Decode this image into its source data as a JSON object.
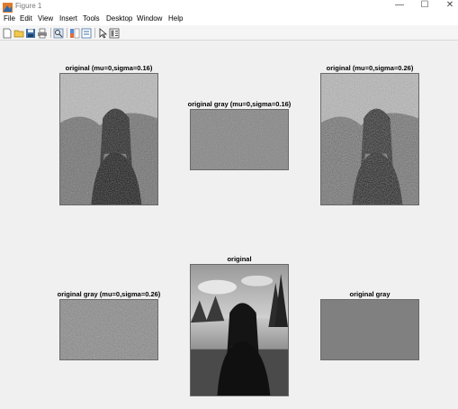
{
  "window": {
    "title": "Figure 1",
    "minimize": "—",
    "maximize": "☐",
    "close": "✕"
  },
  "menu": {
    "items": [
      "File",
      "Edit",
      "View",
      "Insert",
      "Tools",
      "Desktop",
      "Window",
      "Help"
    ]
  },
  "toolbar": {
    "buttons": [
      "new-figure-icon",
      "open-file-icon",
      "save-icon",
      "print-icon",
      "zoom-icon",
      "colorbar-icon",
      "insert-legend-icon",
      "pointer-icon",
      "property-inspector-icon"
    ]
  },
  "figure": {
    "subplots": [
      {
        "title": "original (mu=0,sigma=0.16)",
        "kind": "noisy-portrait"
      },
      {
        "title": "original gray (mu=0,sigma=0.16)",
        "kind": "noise"
      },
      {
        "title": "original (mu=0,sigma=0.26)",
        "kind": "noisy-portrait"
      },
      {
        "title": "original gray (mu=0,sigma=0.26)",
        "kind": "noise"
      },
      {
        "title": "original",
        "kind": "clean-portrait"
      },
      {
        "title": "original gray",
        "kind": "flat-gray"
      }
    ]
  },
  "colors": {
    "flat_gray": "#808080",
    "window_bg": "#f0f0f0",
    "toolbar_bg": "#f5f5f5"
  }
}
